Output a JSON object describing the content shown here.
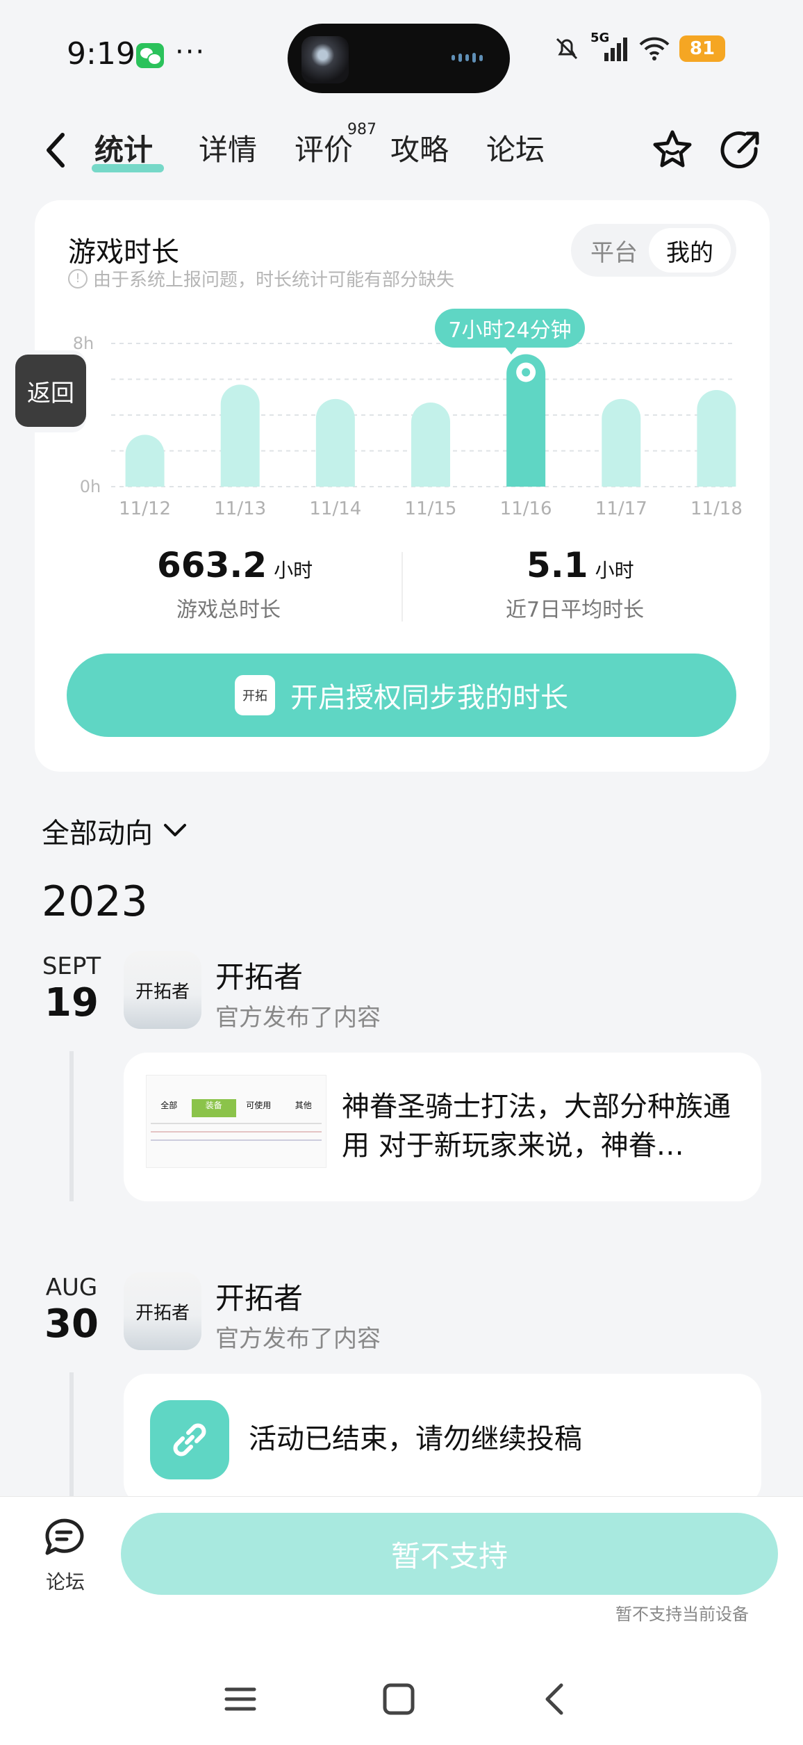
{
  "status_bar": {
    "time": "9:19",
    "more": "···",
    "signal": "5G",
    "battery": "81"
  },
  "nav": {
    "tabs": [
      {
        "label": "统计",
        "active": true
      },
      {
        "label": "详情"
      },
      {
        "label": "评价",
        "badge": "987"
      },
      {
        "label": "攻略"
      },
      {
        "label": "论坛"
      }
    ]
  },
  "playtime": {
    "title": "游戏时长",
    "note": "由于系统上报问题，时长统计可能有部分缺失",
    "toggle": [
      "平台",
      "我的"
    ],
    "selected_toggle": "我的",
    "tooltip": "7小时24分钟",
    "total_value": "663.2",
    "total_unit": "小时",
    "total_label": "游戏总时长",
    "avg_value": "5.1",
    "avg_unit": "小时",
    "avg_label": "近7日平均时长",
    "sync_button": "开启授权同步我的时长"
  },
  "chart_data": {
    "type": "bar",
    "categories": [
      "11/12",
      "11/13",
      "11/14",
      "11/15",
      "11/16",
      "11/17",
      "11/18"
    ],
    "values": [
      2.9,
      5.7,
      4.9,
      4.7,
      7.4,
      4.9,
      5.4
    ],
    "highlighted_index": 4,
    "ylim": [
      0,
      8
    ],
    "yticks": [
      "0h",
      "8h"
    ],
    "grid": true,
    "colors": {
      "bar": "#c3f1ea",
      "highlight": "#5fd6c4"
    }
  },
  "float_back": {
    "label": "返回"
  },
  "feed": {
    "filter_label": "全部动向",
    "year": "2023",
    "entries": [
      {
        "month": "SEPT",
        "day": "19",
        "author": "开拓者",
        "action": "官方发布了内容",
        "text": "神眷圣骑士打法，大部分种族通用 对于新玩家来说，神眷…",
        "thumb_tabs": [
          "全部",
          "装备",
          "可使用",
          "其他"
        ]
      },
      {
        "month": "AUG",
        "day": "30",
        "author": "开拓者",
        "action": "官方发布了内容",
        "text": "活动已结束，请勿继续投稿"
      }
    ]
  },
  "bottom": {
    "forum_label": "论坛",
    "action_button": "暂不支持",
    "action_note": "暂不支持当前设备"
  },
  "colors": {
    "accent": "#5fd6c4",
    "accent_light": "#c3f1ea"
  }
}
